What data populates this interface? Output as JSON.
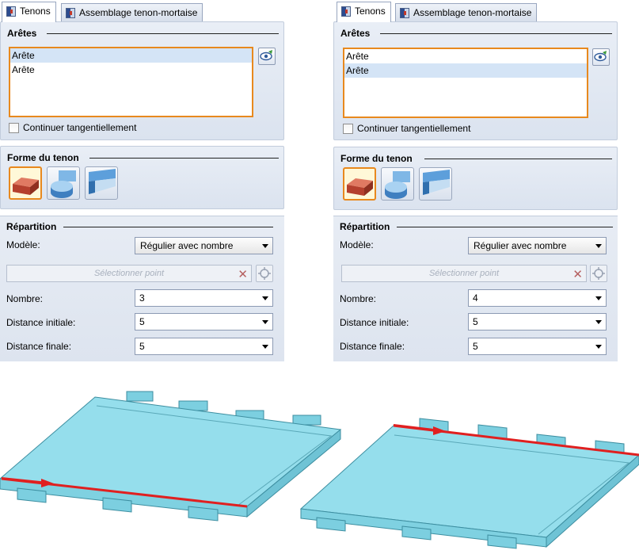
{
  "panels": [
    {
      "tabs": {
        "tenons": "Tenons",
        "assembly": "Assemblage tenon-mortaise"
      },
      "edges": {
        "title": "Arêtes",
        "items": [
          "Arête",
          "Arête"
        ],
        "selected_index": 0,
        "continue_label": "Continuer tangentiellement"
      },
      "shape": {
        "title": "Forme du tenon",
        "selected": "rectangular-tenon-icon"
      },
      "distribution": {
        "title": "Répartition",
        "model_label": "Modèle:",
        "model_value": "Régulier avec nombre",
        "point_placeholder": "Sélectionner point",
        "count_label": "Nombre:",
        "count_value": "3",
        "start_label": "Distance initiale:",
        "start_value": "5",
        "end_label": "Distance finale:",
        "end_value": "5"
      }
    },
    {
      "tabs": {
        "tenons": "Tenons",
        "assembly": "Assemblage tenon-mortaise"
      },
      "edges": {
        "title": "Arêtes",
        "items": [
          "Arête",
          "Arête"
        ],
        "selected_index": 1,
        "continue_label": "Continuer tangentiellement"
      },
      "shape": {
        "title": "Forme du tenon",
        "selected": "rectangular-tenon-icon"
      },
      "distribution": {
        "title": "Répartition",
        "model_label": "Modèle:",
        "model_value": "Régulier avec nombre",
        "point_placeholder": "Sélectionner point",
        "count_label": "Nombre:",
        "count_value": "4",
        "start_label": "Distance initiale:",
        "start_value": "5",
        "end_label": "Distance finale:",
        "end_value": "5"
      }
    }
  ],
  "colors": {
    "accent": "#e8891e",
    "plate": "#8fdcea",
    "edge_highlight": "#e02020",
    "selection": "#d4e4f6"
  }
}
